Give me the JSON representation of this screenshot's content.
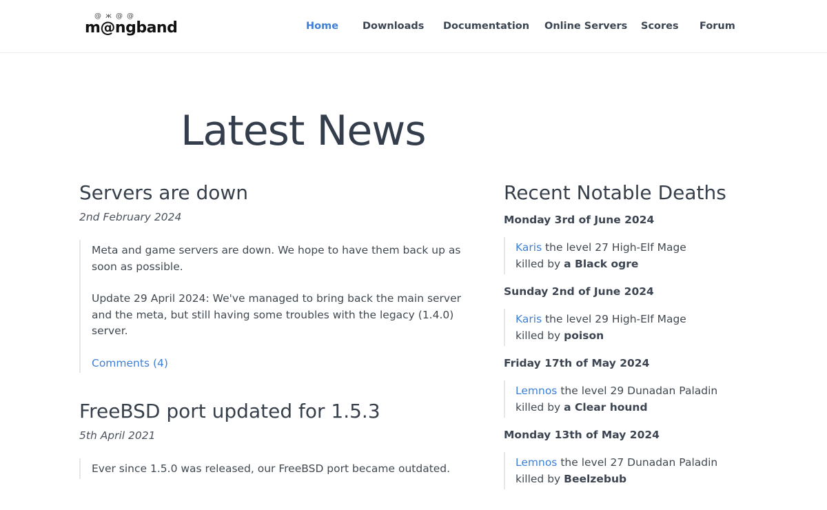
{
  "header": {
    "logo_text": "m@ngband",
    "logo_faces": [
      "@",
      "ж",
      "@",
      "@"
    ],
    "nav": [
      {
        "label": "Home",
        "active": true
      },
      {
        "label": "Downloads",
        "active": false
      },
      {
        "label": "Documentation",
        "active": false
      },
      {
        "label": "Online Servers",
        "active": false
      },
      {
        "label": "Scores",
        "active": false
      },
      {
        "label": "Forum",
        "active": false
      }
    ]
  },
  "main": {
    "title": "Latest News",
    "articles": [
      {
        "title": "Servers are down",
        "date": "2nd February 2024",
        "paragraphs": [
          "Meta and game servers are down. We hope to have them back up as soon as possible.",
          "Update 29 April 2024: We've managed to bring back the main server and the meta, but still having some troubles with the legacy (1.4.0) server."
        ],
        "comments_link": "Comments (4)"
      },
      {
        "title": "FreeBSD port updated for 1.5.3",
        "date": "5th April 2021",
        "paragraphs": [
          "Ever since 1.5.0 was released, our FreeBSD port became outdated."
        ]
      }
    ]
  },
  "sidebar": {
    "title": "Recent Notable Deaths",
    "days": [
      {
        "day": "Monday 3rd of June 2024",
        "player": "Karis",
        "desc": "the level 27 High-Elf Mage",
        "killed_prefix": "killed by",
        "killer": "a Black ogre"
      },
      {
        "day": "Sunday 2nd of June 2024",
        "player": "Karis",
        "desc": "the level 29 High-Elf Mage",
        "killed_prefix": "killed by",
        "killer": "poison"
      },
      {
        "day": "Friday 17th of May 2024",
        "player": "Lemnos",
        "desc": "the level 29 Dunadan Paladin",
        "killed_prefix": "killed by",
        "killer": "a Clear hound"
      },
      {
        "day": "Monday 13th of May 2024",
        "player": "Lemnos",
        "desc": "the level 27 Dunadan Paladin",
        "killed_prefix": "killed by",
        "killer": "Beelzebub"
      }
    ]
  },
  "colors": {
    "accent": "#3d7fd6",
    "text": "#363f4a",
    "border": "#e4e7ea"
  }
}
